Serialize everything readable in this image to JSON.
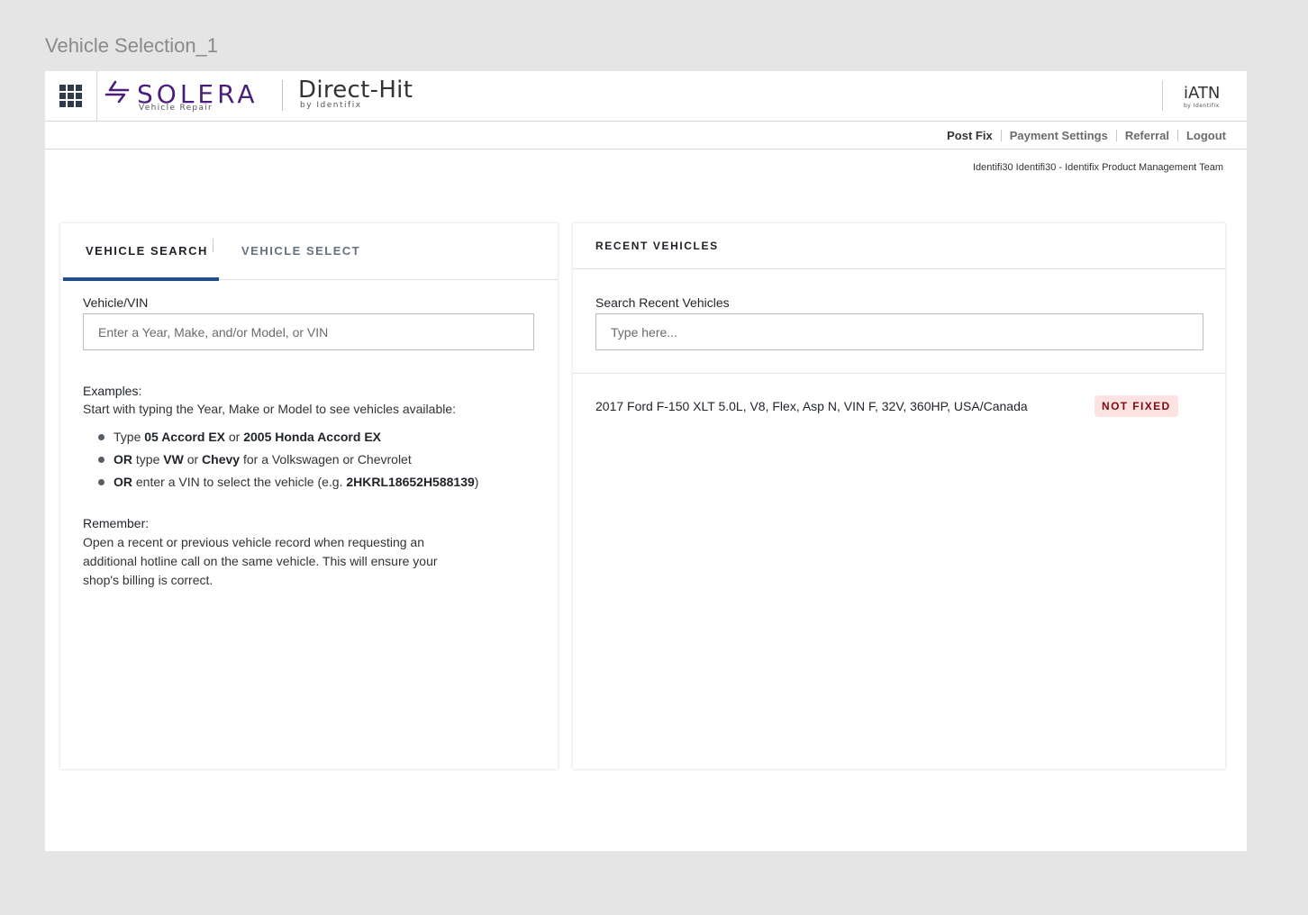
{
  "frame_title": "Vehicle Selection_1",
  "header": {
    "brand_name": "SOLERA",
    "brand_sub": "Vehicle Repair",
    "product_title": "Direct-Hit",
    "product_sub": "by Identifix",
    "partner_title": "iATN",
    "partner_sub": "by Identifix",
    "brand_color": "#4a1f7a"
  },
  "subnav": {
    "links": [
      "Post Fix",
      "Payment Settings",
      "Referral",
      "Logout"
    ]
  },
  "user_line": "Identifi30 Identifi30 - Identifix Product Management Team",
  "search_panel": {
    "tabs": [
      {
        "label": "VEHICLE SEARCH",
        "active": true
      },
      {
        "label": "VEHICLE SELECT",
        "active": false
      }
    ],
    "field_label": "Vehicle/VIN",
    "placeholder": "Enter a Year, Make, and/or Model, or VIN",
    "examples_header": "Examples:",
    "examples_intro": "Start with typing the Year, Make or Model to see vehicles available:",
    "examples": [
      {
        "p1": "Type ",
        "b1": "05 Accord EX",
        "p2": " or ",
        "b2": "2005 Honda Accord EX",
        "p3": ""
      },
      {
        "p0b": "OR",
        "p1": " type ",
        "b1": "VW",
        "p2": " or ",
        "b2": "Chevy",
        "p3": " for a Volkswagen or Chevrolet"
      },
      {
        "p0b": "OR",
        "p1": " enter a VIN to select the vehicle (e.g. ",
        "b1": "2HKRL18652H588139",
        "p2": ")"
      }
    ],
    "remember_header": "Remember:",
    "remember_text": "Open a recent or previous vehicle record when requesting an additional hotline call on the same vehicle. This will ensure your shop's billing is correct."
  },
  "recent_panel": {
    "title": "RECENT VEHICLES",
    "search_label": "Search Recent Vehicles",
    "search_placeholder": "Type here...",
    "vehicles": [
      {
        "description": "2017 Ford F-150 XLT 5.0L, V8, Flex, Asp N, VIN F, 32V, 360HP, USA/Canada",
        "status": "NOT FIXED",
        "status_color": "#7a0b12"
      }
    ]
  },
  "accent_color": "#1f4e8c"
}
